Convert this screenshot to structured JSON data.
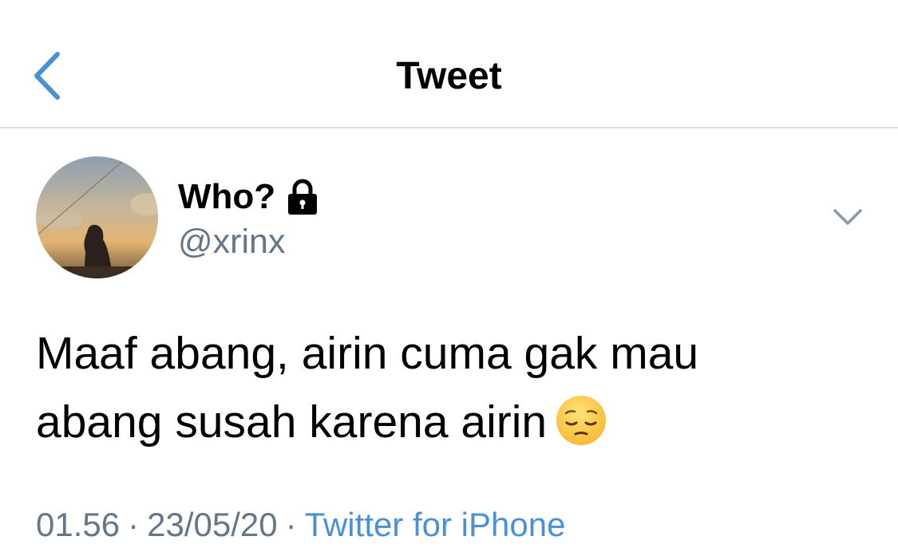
{
  "header": {
    "title": "Tweet",
    "back_icon": "chevron-left-icon"
  },
  "tweet": {
    "display_name": "Who?",
    "protected_icon": "lock-icon",
    "handle": "@xrinx",
    "menu_icon": "chevron-down-icon",
    "text_lines": [
      "Maaf abang, airin cuma gak mau",
      "abang susah karena airin"
    ],
    "emoji": "pensive-face-emoji",
    "time": "01.56",
    "date": "23/05/20",
    "separator": "·",
    "source": "Twitter for iPhone"
  },
  "colors": {
    "accent": "#4a90d9",
    "secondary_text": "#657786",
    "divider": "#dcdde0"
  }
}
